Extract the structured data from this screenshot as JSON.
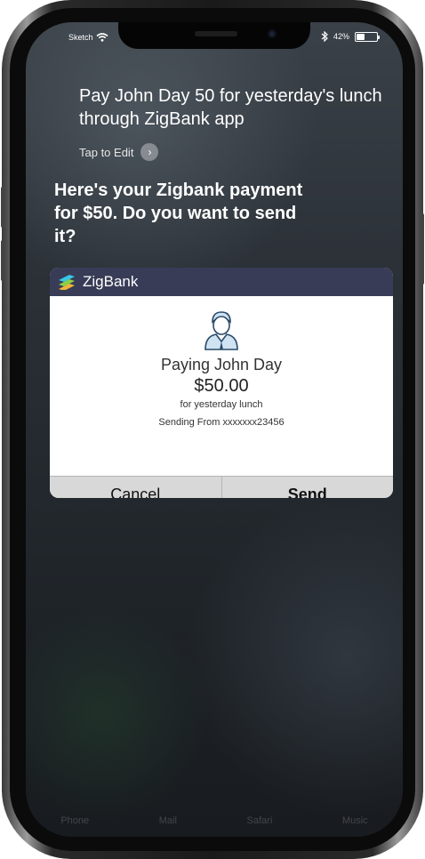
{
  "status": {
    "carrier": "Sketch",
    "battery_text": "42%",
    "battery_level": 0.42
  },
  "siri": {
    "query": "Pay John Day 50 for yesterday's lunch through ZigBank app",
    "tap_to_edit": "Tap to Edit",
    "response": "Here's your Zigbank payment for $50. Do you want to send it?"
  },
  "card": {
    "app_name": "ZigBank",
    "payee": "Paying John Day",
    "amount": "$50.00",
    "memo": "for yesterday lunch",
    "account": "Sending From xxxxxxx23456",
    "cancel_label": "Cancel",
    "send_label": "Send"
  },
  "dock": [
    "Phone",
    "Mail",
    "Safari",
    "Music"
  ],
  "colors": {
    "card_header": "#383c56",
    "button_bar": "#d8d8d8"
  }
}
